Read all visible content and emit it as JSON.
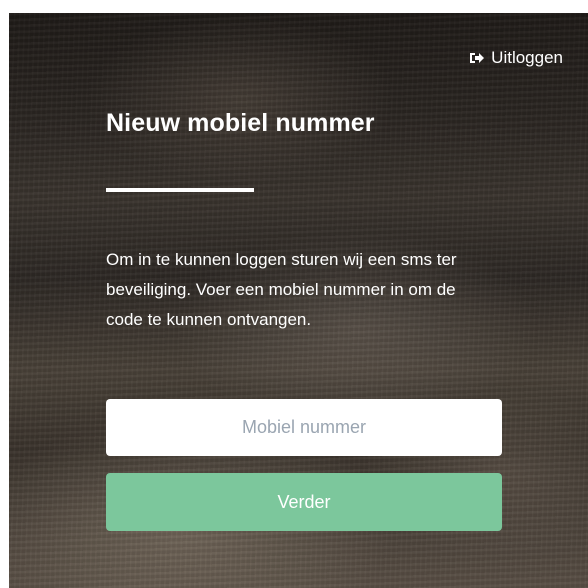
{
  "header": {
    "logout_label": "Uitloggen",
    "logout_icon": "sign-out-icon"
  },
  "main": {
    "title": "Nieuw mobiel nummer",
    "description": "Om in te kunnen loggen sturen wij een sms ter beveiliging. Voer een mobiel nummer in om de code te kunnen ontvangen.",
    "phone_input": {
      "placeholder": "Mobiel nummer",
      "value": ""
    },
    "next_label": "Verder"
  },
  "colors": {
    "button": "#7cc79c",
    "text": "#ffffff",
    "placeholder": "#9aa5b1"
  }
}
